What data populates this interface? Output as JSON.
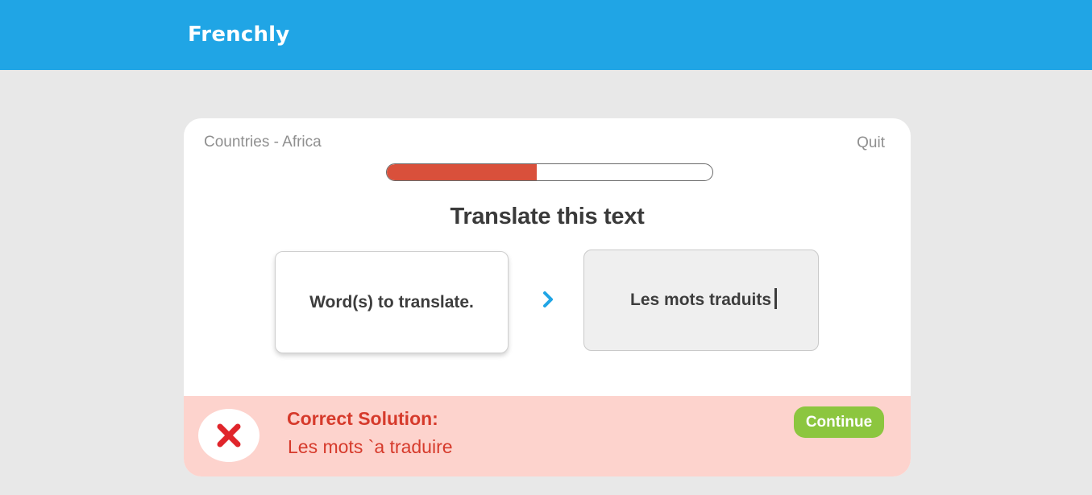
{
  "app": {
    "brand": "Frenchly",
    "brand_color": "#20a5e5"
  },
  "lesson": {
    "title": "Countries - Africa",
    "quit_label": "Quit",
    "progress": 0.46
  },
  "exercise": {
    "prompt": "Translate this text",
    "source_text": "Word(s) to translate.",
    "user_answer": "Les mots traduits",
    "arrow_icon": "chevron-right-icon"
  },
  "feedback": {
    "status": "incorrect",
    "status_icon": "close-icon",
    "title": "Correct Solution:",
    "solution": "Les mots `a traduire",
    "continue_label": "Continue",
    "error_color": "#d63a2b",
    "success_color": "#8cc63f"
  }
}
